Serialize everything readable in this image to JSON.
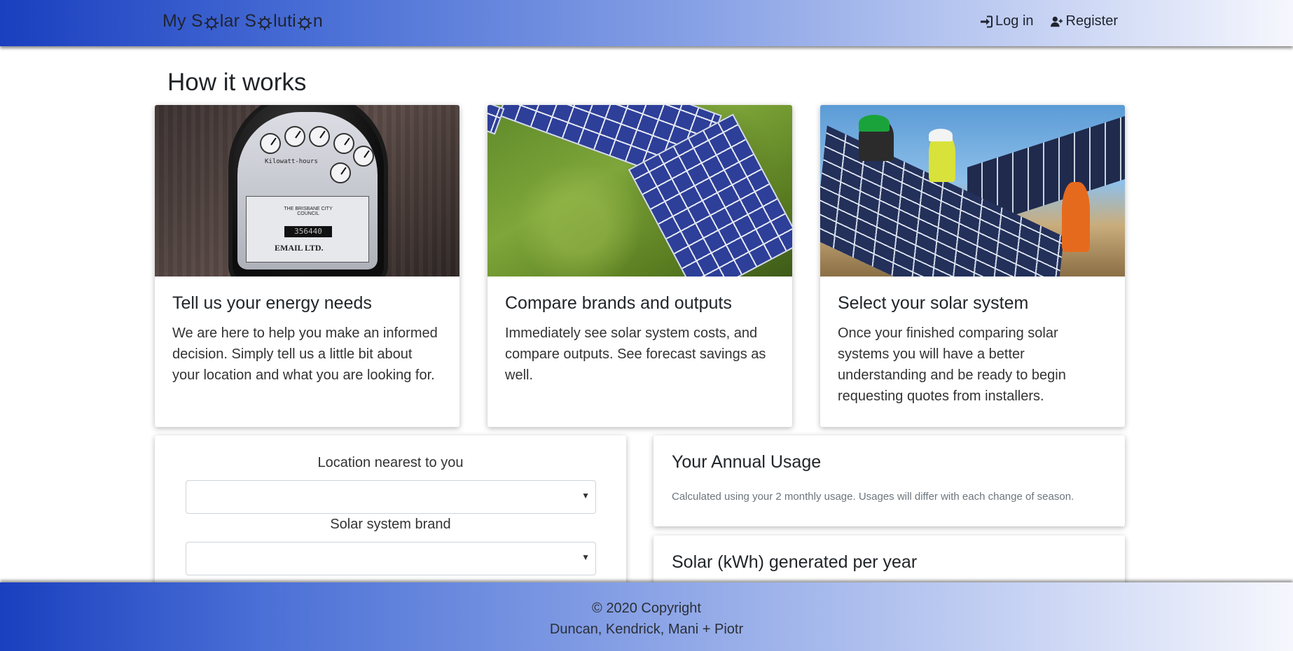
{
  "navbar": {
    "brand_parts": [
      "My S",
      "lar S",
      "luti",
      "n"
    ],
    "login_label": "Log in",
    "register_label": "Register"
  },
  "page": {
    "title": "How it works"
  },
  "info_cards": [
    {
      "title": "Tell us your energy needs",
      "text": "We are here to help you make an informed decision. Simply tell us a little bit about your location and what you are looking for.",
      "image": "electricity-meter",
      "image_text": {
        "label": "Kilowatt-hours",
        "council": "THE BRISBANE CITY COUNCIL",
        "reading": "356440",
        "maker": "EMAIL LTD."
      }
    },
    {
      "title": "Compare brands and outputs",
      "text": "Immediately see solar system costs, and compare outputs. See forecast savings as well.",
      "image": "solar-panels-on-grass"
    },
    {
      "title": "Select your solar system",
      "text": "Once your finished comparing solar systems you will have a better understanding and be ready to begin requesting quotes from installers.",
      "image": "workers-installing-panels"
    }
  ],
  "form": {
    "location_label": "Location nearest to you",
    "location_value": "",
    "brand_label": "Solar system brand",
    "brand_value": ""
  },
  "usage": {
    "title": "Your Annual Usage",
    "note": "Calculated using your 2 monthly usage. Usages will differ with each change of season."
  },
  "solar": {
    "title": "Solar (kWh) generated per year"
  },
  "footer": {
    "copyright": "© 2020 Copyright",
    "authors": "Duncan, Kendrick, Mani + Piotr"
  },
  "colors": {
    "nav_gradient_start": "#1a3fbf",
    "nav_gradient_end": "#f6f7fd"
  },
  "icons": [
    "sun-icon",
    "sign-in-icon",
    "user-plus-icon",
    "chevron-down-icon"
  ]
}
